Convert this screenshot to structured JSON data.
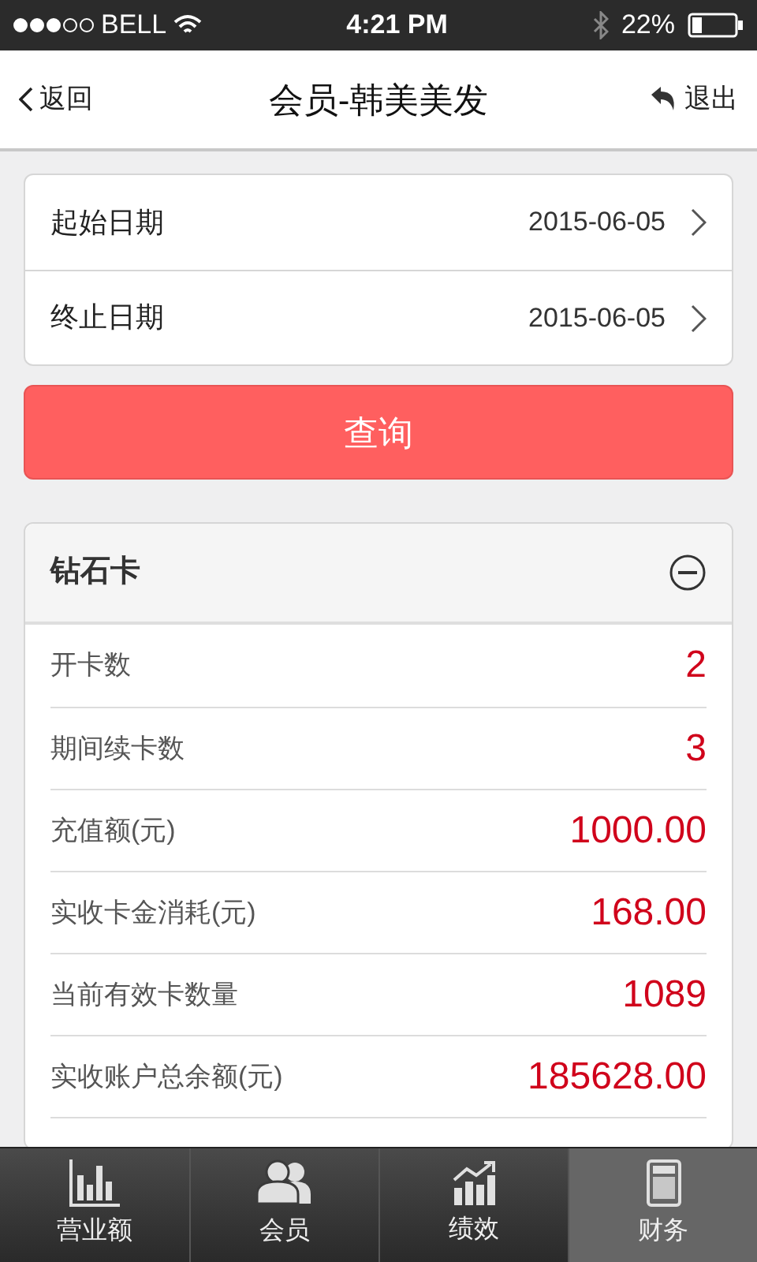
{
  "status_bar": {
    "carrier": "BELL",
    "time": "4:21 PM",
    "battery": "22%"
  },
  "nav": {
    "back": "返回",
    "title": "会员-韩美美发",
    "exit": "退出"
  },
  "dates": [
    {
      "label": "起始日期",
      "value": "2015-06-05"
    },
    {
      "label": "终止日期",
      "value": "2015-06-05"
    }
  ],
  "query_button": "查询",
  "card": {
    "title": "钻石卡",
    "expanded": true,
    "rows": [
      {
        "label": "开卡数",
        "value": "2"
      },
      {
        "label": "期间续卡数",
        "value": "3"
      },
      {
        "label": "充值额(元)",
        "value": "1000.00"
      },
      {
        "label": "实收卡金消耗(元)",
        "value": "168.00"
      },
      {
        "label": "当前有效卡数量",
        "value": "1089"
      },
      {
        "label": "实收账户总余额(元)",
        "value": "185628.00"
      }
    ]
  },
  "tabs": [
    {
      "label": "营业额",
      "kind": "bars",
      "selected": false
    },
    {
      "label": "会员",
      "kind": "people",
      "selected": false
    },
    {
      "label": "绩效",
      "kind": "growth",
      "selected": false
    },
    {
      "label": "财务",
      "kind": "calculator",
      "selected": true
    }
  ]
}
